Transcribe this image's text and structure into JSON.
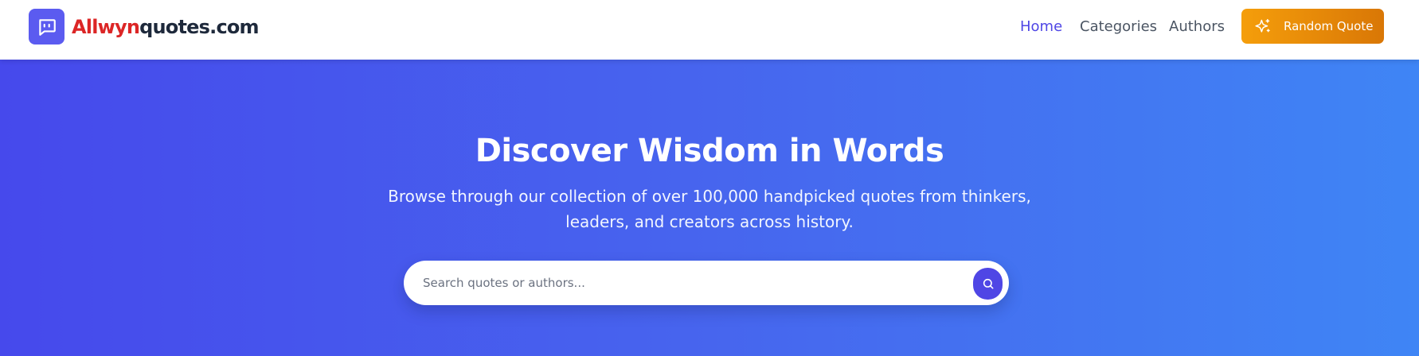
{
  "header": {
    "logo": {
      "brand_highlight": "Allwyn",
      "brand_rest": "quotes.com",
      "icon": "chat-quote-icon"
    },
    "nav": [
      {
        "label": "Home",
        "active": true
      },
      {
        "label": "Categories",
        "active": false
      },
      {
        "label": "Authors",
        "active": false
      }
    ],
    "random_button": {
      "label": "Random Quote",
      "icon": "sparkles-icon"
    }
  },
  "hero": {
    "title": "Discover Wisdom in Words",
    "subtitle": "Browse through our collection of over 100,000 handpicked quotes from thinkers, leaders, and creators across history.",
    "search": {
      "placeholder": "Search quotes or authors...",
      "value": "",
      "button_icon": "search-icon"
    }
  },
  "colors": {
    "accent": "#4f46e5",
    "brand_red": "#dc2626",
    "button_orange": "#f59e0b",
    "hero_gradient_start": "#4649ec",
    "hero_gradient_end": "#3f85f5"
  }
}
